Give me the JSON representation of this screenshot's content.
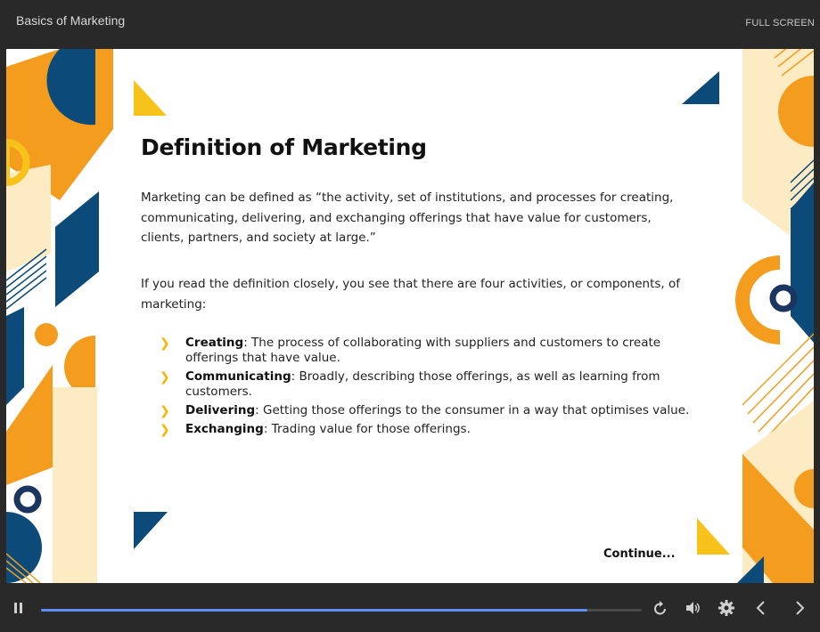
{
  "header": {
    "course_title": "Basics of Marketing",
    "fullscreen_label": "FULL SCREEN"
  },
  "slide": {
    "title": "Definition of Marketing",
    "paragraph1": "Marketing can be defined as “the activity, set of institutions, and processes for creating, communicating, delivering, and exchanging offerings that have value for customers, clients, partners, and society at large.”",
    "paragraph2": "If you read the definition closely, you see that there are four activities, or components, of marketing:",
    "bullets": [
      {
        "term": "Creating",
        "text": ": The process of collaborating with suppliers and customers to create offerings that have value."
      },
      {
        "term": "Communicating",
        "text": ": Broadly, describing those offerings, as well as learning from customers."
      },
      {
        "term": "Delivering",
        "text": ": Getting those offerings to the consumer in a way that optimises value."
      },
      {
        "term": "Exchanging",
        "text": ": Trading value for those offerings."
      }
    ],
    "continue_label": "Continue..."
  },
  "player": {
    "progress_fraction": 0.91,
    "icons": [
      "pause-icon",
      "replay-icon",
      "volume-icon",
      "settings-icon",
      "previous-icon",
      "next-icon"
    ]
  },
  "colors": {
    "orange": "#f39c1e",
    "yellow": "#f7c21a",
    "navy": "#0c4a7a",
    "cream": "#fdebc4",
    "chrome": "#292929",
    "progress": "#5b8ff0"
  }
}
